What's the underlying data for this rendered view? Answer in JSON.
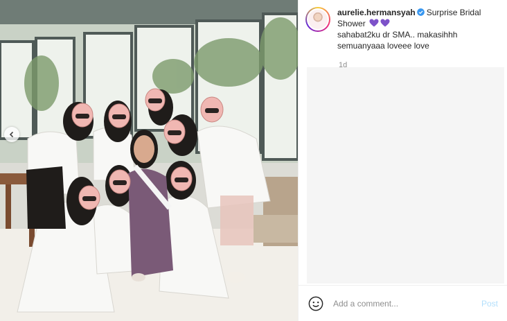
{
  "post": {
    "username": "aurelie.hermansyah",
    "caption_title": "Surprise Bridal Shower",
    "caption_line2": "sahabat2ku dr SMA.. makasihhh",
    "caption_line3": "semuanyaaa loveee love",
    "timestamp": "1d"
  },
  "comment_box": {
    "placeholder": "Add a comment...",
    "post_label": "Post"
  },
  "colors": {
    "heart": "#7d52c9",
    "verified": "#3897f0",
    "post_disabled": "#b2dffc"
  },
  "icons": {
    "emoji": "smiley-icon",
    "verified": "verified-badge-icon",
    "carousel": "chevron-left-icon"
  }
}
